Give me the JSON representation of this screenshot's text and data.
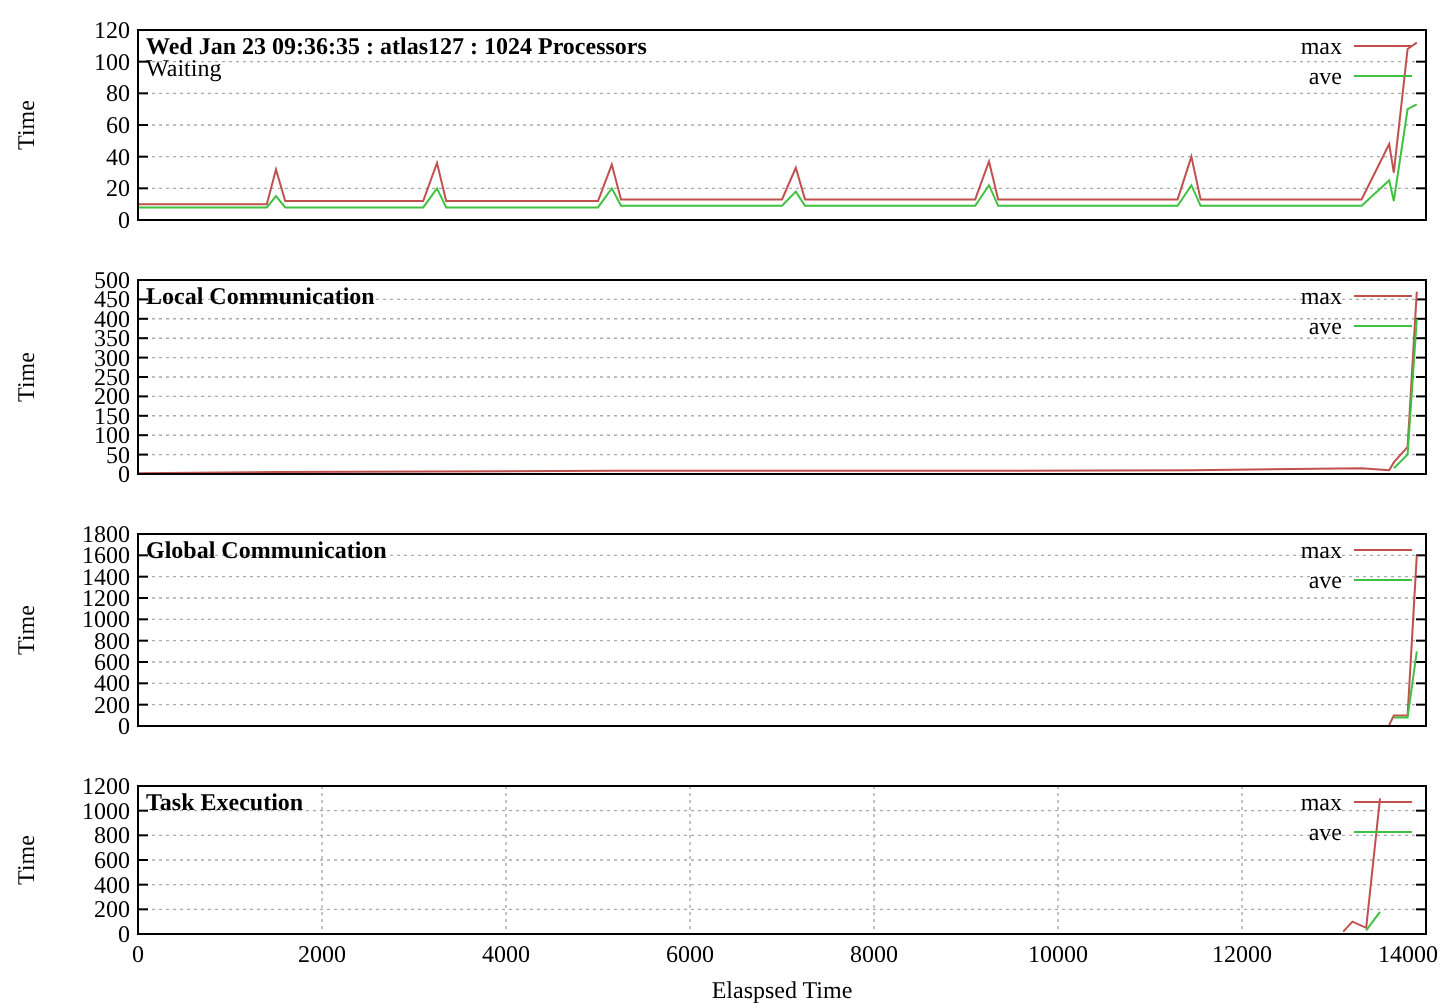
{
  "charts": [
    {
      "header": "Wed Jan 23 09:36:35 : atlas127 : 1024 Processors",
      "chart_data": {
        "type": "line",
        "title": "Waiting",
        "ylabel": "Time",
        "xlim": [
          0,
          14000
        ],
        "ylim": [
          0,
          120
        ],
        "yticks": [
          0,
          20,
          40,
          60,
          80,
          100,
          120
        ],
        "grid": true,
        "legend": true,
        "x": [
          0,
          1400,
          1500,
          1600,
          3100,
          3250,
          3350,
          5000,
          5150,
          5250,
          7000,
          7150,
          7250,
          9100,
          9250,
          9350,
          11300,
          11450,
          11550,
          13300,
          13600,
          13650,
          13800,
          13900
        ],
        "series": [
          {
            "name": "max",
            "color": "#c0504d",
            "values": [
              10,
              10,
              32,
              12,
              12,
              36,
              12,
              12,
              35,
              13,
              13,
              33,
              13,
              13,
              37,
              13,
              13,
              40,
              13,
              13,
              48,
              30,
              108,
              112
            ]
          },
          {
            "name": "ave",
            "color": "#40c040",
            "values": [
              8,
              8,
              15,
              8,
              8,
              20,
              8,
              8,
              20,
              9,
              9,
              18,
              9,
              9,
              22,
              9,
              9,
              22,
              9,
              9,
              25,
              12,
              70,
              73
            ]
          }
        ]
      }
    },
    {
      "chart_data": {
        "type": "line",
        "title": "Local Communication",
        "ylabel": "Time",
        "xlim": [
          0,
          14000
        ],
        "ylim": [
          0,
          500
        ],
        "yticks": [
          0,
          50,
          100,
          150,
          200,
          250,
          300,
          350,
          400,
          450,
          500
        ],
        "grid": true,
        "legend": true,
        "x": [
          0,
          1500,
          3250,
          5150,
          7150,
          9250,
          11450,
          13300,
          13600,
          13650,
          13800,
          13900
        ],
        "series": [
          {
            "name": "max",
            "color": "#c0504d",
            "values": [
              2,
              5,
              6,
              8,
              8,
              8,
              10,
              15,
              10,
              30,
              70,
              470
            ]
          },
          {
            "name": "ave",
            "color": "#40c040",
            "values": [
              null,
              null,
              null,
              null,
              null,
              null,
              null,
              null,
              null,
              15,
              50,
              400
            ]
          }
        ]
      }
    },
    {
      "chart_data": {
        "type": "line",
        "title": "Global Communication",
        "ylabel": "Time",
        "xlim": [
          0,
          14000
        ],
        "ylim": [
          0,
          1800
        ],
        "yticks": [
          0,
          200,
          400,
          600,
          800,
          1000,
          1200,
          1400,
          1600,
          1800
        ],
        "grid": true,
        "legend": true,
        "x": [
          13600,
          13650,
          13800,
          13900
        ],
        "series": [
          {
            "name": "max",
            "color": "#c0504d",
            "values": [
              10,
              100,
              100,
              1600
            ]
          },
          {
            "name": "ave",
            "color": "#40c040",
            "values": [
              null,
              80,
              80,
              700
            ]
          }
        ]
      }
    },
    {
      "chart_data": {
        "type": "line",
        "title": "Task Execution",
        "xlabel": "Elaspsed Time",
        "ylabel": "Time",
        "xlim": [
          0,
          14000
        ],
        "ylim": [
          0,
          1200
        ],
        "yticks": [
          0,
          200,
          400,
          600,
          800,
          1000,
          1200
        ],
        "xticks": [
          0,
          2000,
          4000,
          6000,
          8000,
          10000,
          12000,
          14000
        ],
        "grid": true,
        "legend": true,
        "x": [
          13100,
          13200,
          13350,
          13500
        ],
        "series": [
          {
            "name": "max",
            "color": "#c0504d",
            "values": [
              20,
              100,
              50,
              1100
            ]
          },
          {
            "name": "ave",
            "color": "#40c040",
            "values": [
              null,
              null,
              30,
              180
            ]
          }
        ]
      }
    }
  ]
}
